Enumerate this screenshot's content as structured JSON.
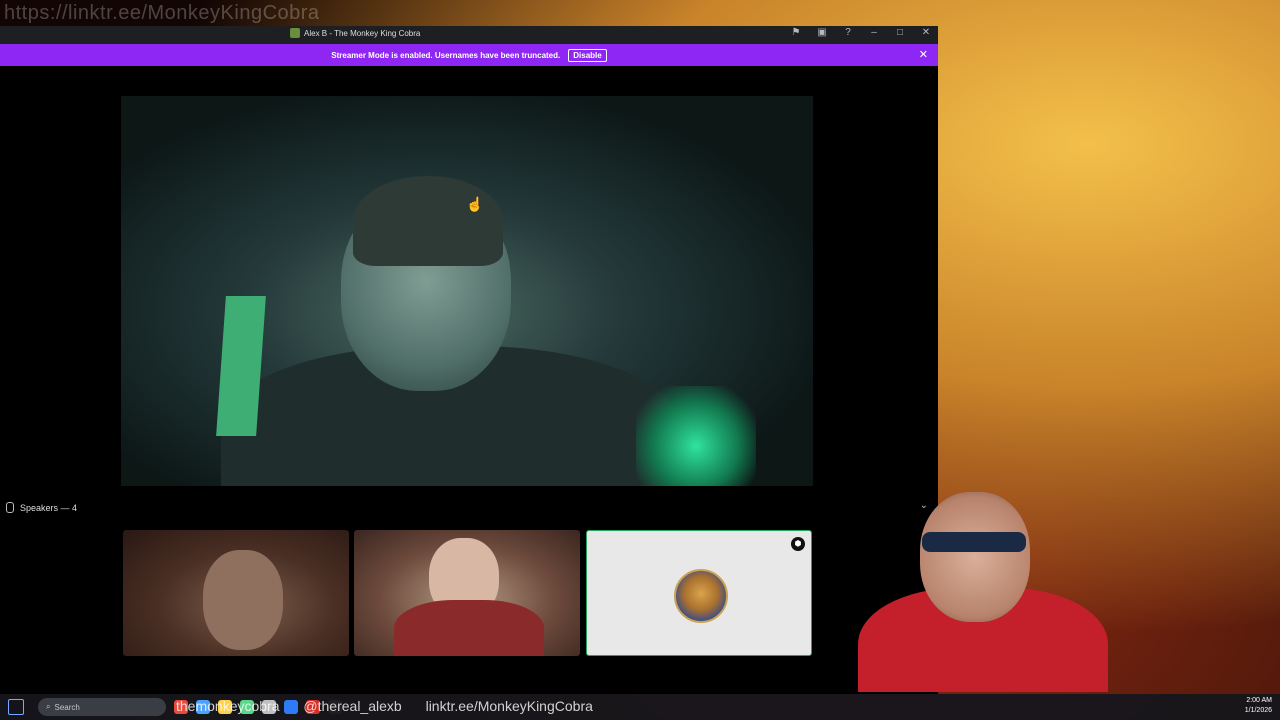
{
  "overlay": {
    "top_url": "https://linktr.ee/MonkeyKingCobra"
  },
  "window": {
    "title": "Alex B - The Monkey King Cobra",
    "titlebar_icons": [
      "flag-icon",
      "screen-icon",
      "help-icon",
      "minimize-icon",
      "maximize-icon",
      "close-icon"
    ],
    "titlebar_glyphs": {
      "flag": "⚑",
      "screen": "▣",
      "help": "?",
      "minimize": "–",
      "maximize": "□",
      "close": "✕"
    }
  },
  "streamer_bar": {
    "message": "Streamer Mode is enabled. Usernames have been truncated.",
    "button_label": "Disable",
    "close_glyph": "✕",
    "color": "#8f27f4"
  },
  "voice": {
    "speakers_label": "Speakers — 4",
    "collapse_glyph": "⌄"
  },
  "cursor_glyph": "☝",
  "tile3_badge_glyph": "⬢",
  "taskbar": {
    "search_placeholder": "Search",
    "social_handles": [
      "themonkeycobra",
      "@thereal_alexb",
      "linktr.ee/MonkeyKingCobra"
    ],
    "time": "2:00 AM",
    "date": "1/1/2026",
    "app_colors": [
      "#e84a3c",
      "#4aa3ff",
      "#ffd24a",
      "#5bd68a",
      "#c0c0c0",
      "#2f7bf5",
      "#d9312a",
      "#1f1f1f"
    ]
  },
  "colors": {
    "accent": "#8f27f4",
    "speaking_border": "#23a55a",
    "titlebar": "#1e1f22"
  }
}
